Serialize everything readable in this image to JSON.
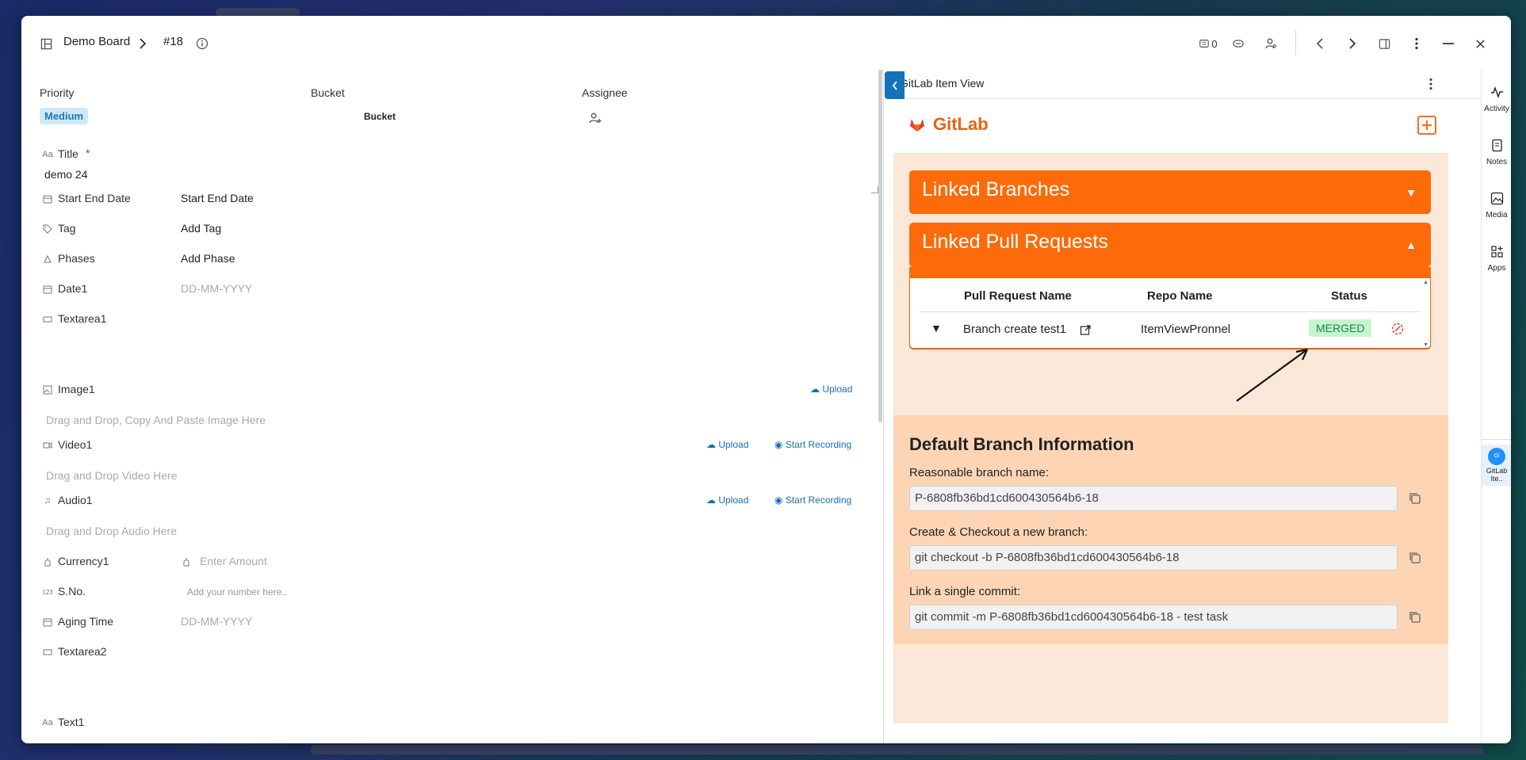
{
  "header": {
    "board": "Demo Board",
    "item_id": "#18",
    "watch_count": "0"
  },
  "form": {
    "priority_label": "Priority",
    "priority_value": "Medium",
    "bucket_label": "Bucket",
    "bucket_value": "Bucket",
    "assignee_label": "Assignee",
    "title_label": "Title",
    "title_required": "*",
    "title_value": "demo 24",
    "fields": {
      "start_end_label": "Start End Date",
      "start_end_value": "Start End Date",
      "tag_label": "Tag",
      "tag_value": "Add Tag",
      "phases_label": "Phases",
      "phases_value": "Add Phase",
      "date1_label": "Date1",
      "date1_placeholder": "DD-MM-YYYY",
      "textarea1_label": "Textarea1",
      "image1_label": "Image1",
      "image1_upload": "Upload",
      "image1_placeholder": "Drag and Drop, Copy And Paste Image Here",
      "video1_label": "Video1",
      "video1_upload": "Upload",
      "video1_record": "Start Recording",
      "video1_placeholder": "Drag and Drop Video Here",
      "audio1_label": "Audio1",
      "audio1_upload": "Upload",
      "audio1_record": "Start Recording",
      "audio1_placeholder": "Drag and Drop Audio Here",
      "currency1_label": "Currency1",
      "currency1_placeholder": "Enter Amount",
      "sno_label": "S.No.",
      "sno_placeholder": "Add your number here..",
      "aging_label": "Aging Time",
      "aging_placeholder": "DD-MM-YYYY",
      "textarea2_label": "Textarea2",
      "text1_label": "Text1"
    }
  },
  "gitlab": {
    "pane_title": "GitLab Item View",
    "brand": "GitLab",
    "linked_branches": "Linked Branches",
    "linked_prs": "Linked Pull Requests",
    "table": {
      "headers": [
        "Pull Request Name",
        "Repo Name",
        "Status"
      ],
      "rows": [
        {
          "name": "Branch create test1",
          "repo": "ItemViewPronnel",
          "status": "MERGED"
        }
      ]
    },
    "default_branch": {
      "title": "Default Branch Information",
      "reasonable_label": "Reasonable branch name:",
      "reasonable_value": "P-6808fb36bd1cd600430564b6-18",
      "checkout_label": "Create & Checkout a new branch:",
      "checkout_value": "git checkout -b P-6808fb36bd1cd600430564b6-18",
      "commit_label": "Link a single commit:",
      "commit_value": "git commit -m P-6808fb36bd1cd600430564b6-18 - test task"
    }
  },
  "rail": {
    "activity": "Activity",
    "notes": "Notes",
    "media": "Media",
    "apps": "Apps",
    "gitlab_app": "GitLab Ite..",
    "gitlab_badge": "Gl"
  },
  "colors": {
    "accent": "#1672b8",
    "gitlab_orange": "#fd6a0a",
    "merged_bg": "#c5f5d0",
    "merged_text": "#1d8a3a"
  }
}
